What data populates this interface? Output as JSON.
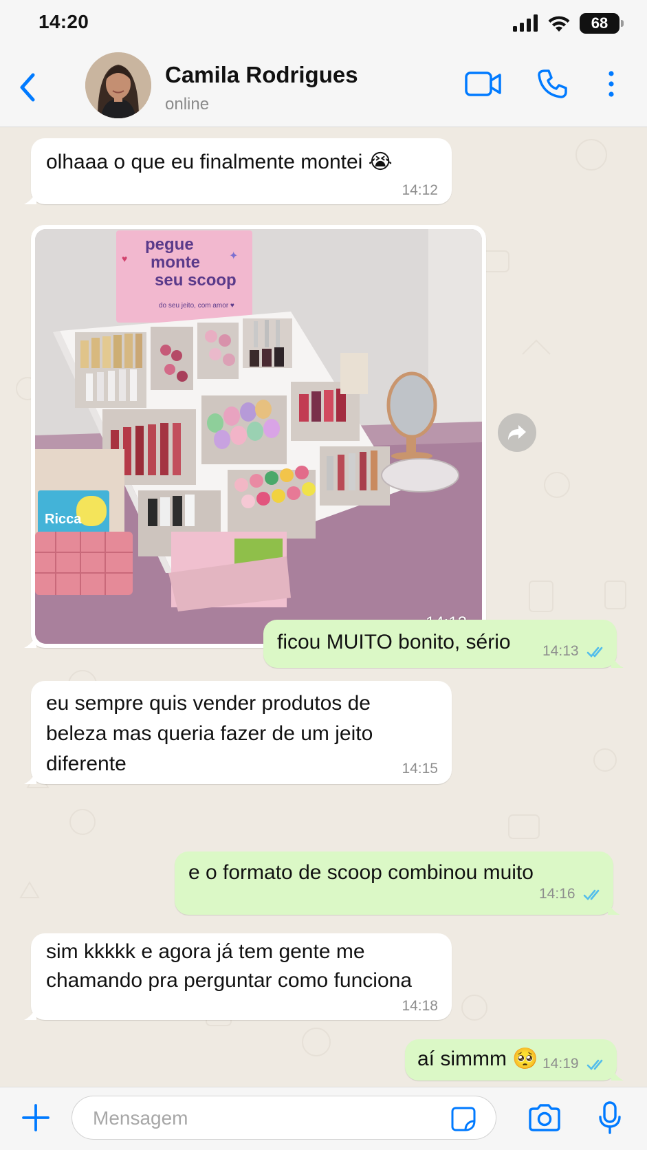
{
  "status_bar": {
    "time": "14:20",
    "battery": "68"
  },
  "header": {
    "contact_name": "Camila Rodrigues",
    "contact_status": "online"
  },
  "messages": [
    {
      "dir": "in",
      "lines": [
        "olhaaa o que eu finalmente montei 😭"
      ],
      "time": "14:12"
    },
    {
      "dir": "in",
      "type": "image",
      "alt": "",
      "time": "14:12",
      "image_text": {
        "sign_line1": "pegue",
        "sign_line2": "monte",
        "sign_line3": "seu scoop",
        "sign_small": "do seu jeito, com amor ♥",
        "bag_label": "Ricca"
      }
    },
    {
      "dir": "out",
      "lines": [
        "ficou MUITO bonito, sério"
      ],
      "time": "14:13",
      "status": "read"
    },
    {
      "dir": "in",
      "lines": [
        "eu sempre quis vender produtos de",
        "beleza mas queria fazer de um jeito",
        "diferente"
      ],
      "time": "14:15"
    },
    {
      "dir": "out",
      "lines": [
        "e o formato de scoop combinou muito"
      ],
      "time": "14:16",
      "status": "read"
    },
    {
      "dir": "in",
      "lines": [
        "sim kkkkk e agora já tem gente me",
        "chamando pra perguntar como funciona"
      ],
      "time": "14:18"
    },
    {
      "dir": "out",
      "lines": [
        "aí simmm 🥺"
      ],
      "time": "14:19",
      "status": "read"
    }
  ],
  "composer": {
    "placeholder": "Mensagem"
  },
  "colors": {
    "accent": "#007aff",
    "outgoing_bubble": "#dbf8c6",
    "incoming_bubble": "#ffffff",
    "read_ticks": "#53bdeb",
    "wallpaper": "#efeae2"
  },
  "icons": {
    "back": "chevron-left-icon",
    "video": "video-call-icon",
    "phone": "phone-icon",
    "menu": "more-vertical-icon",
    "forward": "forward-icon",
    "plus": "plus-icon",
    "sticker": "sticker-icon",
    "camera": "camera-icon",
    "mic": "microphone-icon"
  }
}
